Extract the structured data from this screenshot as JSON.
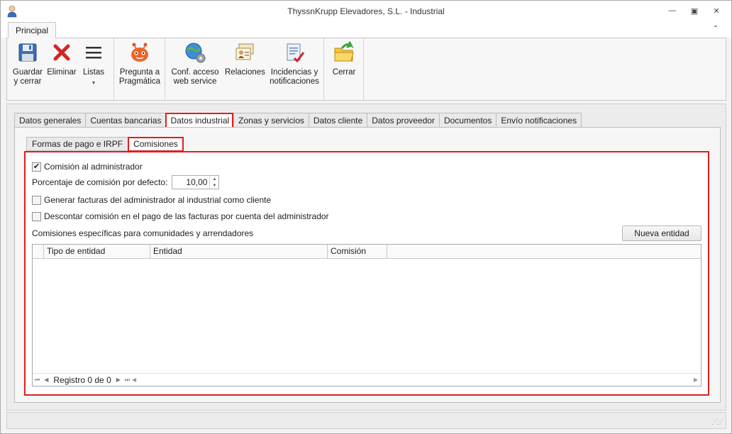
{
  "window": {
    "title": "ThyssnKrupp Elevadores, S.L. - Industrial",
    "min_glyph": "—",
    "restore_glyph": "▣",
    "close_glyph": "✕"
  },
  "ribbon": {
    "tab": "Principal",
    "collapse_glyph": "⌃",
    "buttons": {
      "guardar": "Guardar\ny cerrar",
      "eliminar": "Eliminar",
      "listas": "Listas",
      "pregunta": "Pregunta a\nPragmática",
      "conf": "Conf. acceso\nweb service",
      "relaciones": "Relaciones",
      "incidencias": "Incidencias y\nnotificaciones",
      "cerrar": "Cerrar"
    },
    "dropdown_glyph": "▼"
  },
  "tabs": [
    "Datos generales",
    "Cuentas bancarias",
    "Datos industrial",
    "Zonas y servicios",
    "Datos cliente",
    "Datos proveedor",
    "Documentos",
    "Envío notificaciones"
  ],
  "active_tab": "Datos industrial",
  "subtabs": [
    "Formas de pago e IRPF",
    "Comisiones"
  ],
  "active_subtab": "Comisiones",
  "comisiones": {
    "comision_admin_label": "Comisión al administrador",
    "comision_admin_checked": true,
    "porcentaje_label": "Porcentaje de comisión por defecto:",
    "porcentaje_value": "10,00",
    "generar_label": "Generar facturas del administrador al industrial como cliente",
    "generar_checked": false,
    "descontar_label": "Descontar comisión en el pago de las facturas por cuenta del administrador",
    "descontar_checked": false,
    "especificas_label": "Comisiones específicas para comunidades y arrendadores",
    "nueva_entidad": "Nueva entidad"
  },
  "grid": {
    "columns": [
      "Tipo de entidad",
      "Entidad",
      "Comisión"
    ],
    "rows": [],
    "navigator_text": "Registro 0 de 0"
  },
  "colors": {
    "highlight": "#e11e1e"
  }
}
